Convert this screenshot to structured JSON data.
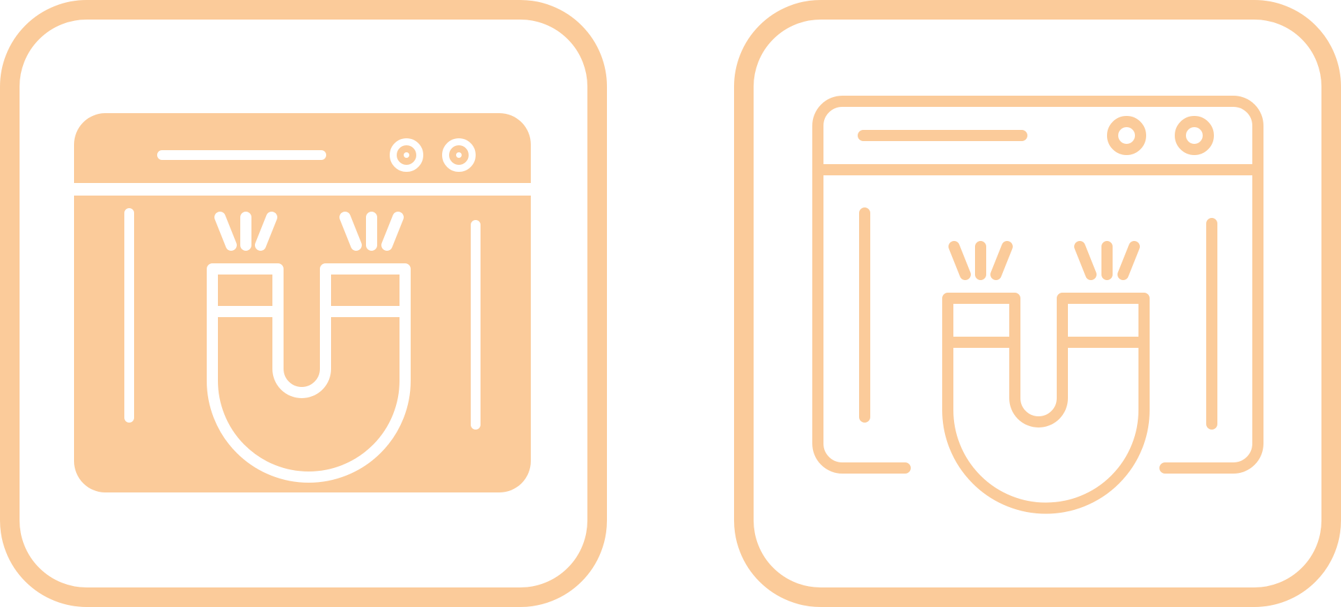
{
  "icons": [
    {
      "variant": "filled",
      "icon": "browser-magnet-icon"
    },
    {
      "variant": "outline",
      "icon": "browser-magnet-icon"
    }
  ],
  "colors": {
    "accent": "#FBCB9A",
    "background": "#FFFFFF"
  }
}
